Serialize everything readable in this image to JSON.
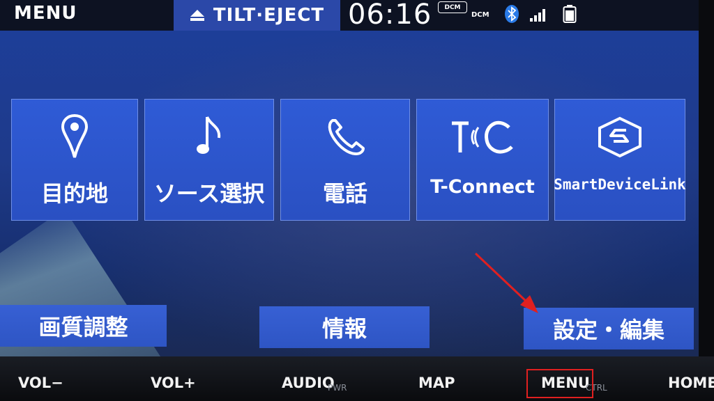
{
  "statusbar": {
    "menu_title": "MENU",
    "tilt_eject_label": "TILT·EJECT",
    "clock": "06:16",
    "dcm_badge": "DCM",
    "dcm_label": "DCM",
    "icons": [
      "eject-icon",
      "bluetooth-icon",
      "signal-icon",
      "battery-icon"
    ]
  },
  "tiles": [
    {
      "label": "目的地",
      "icon": "location-pin-icon"
    },
    {
      "label": "ソース選択",
      "icon": "music-note-icon"
    },
    {
      "label": "電話",
      "icon": "phone-icon"
    },
    {
      "label": "T-Connect",
      "icon": "tconnect-logo-icon"
    },
    {
      "label": "SmartDeviceLink",
      "icon": "smartdevicelink-icon"
    }
  ],
  "buttons": {
    "picture_quality": "画質調整",
    "info": "情報",
    "settings_edit": "設定・編集"
  },
  "hardware": {
    "vol_down": "VOL−",
    "vol_up": "VOL+",
    "audio": "AUDIO",
    "pwr": "PWR",
    "map": "MAP",
    "menu": "MENU",
    "ctrl": "CTRL",
    "home": "HOME"
  },
  "colors": {
    "screen_blue": "#1e3a8a",
    "tile_blue": "#2f5bd6",
    "annotation_red": "#e02020"
  }
}
